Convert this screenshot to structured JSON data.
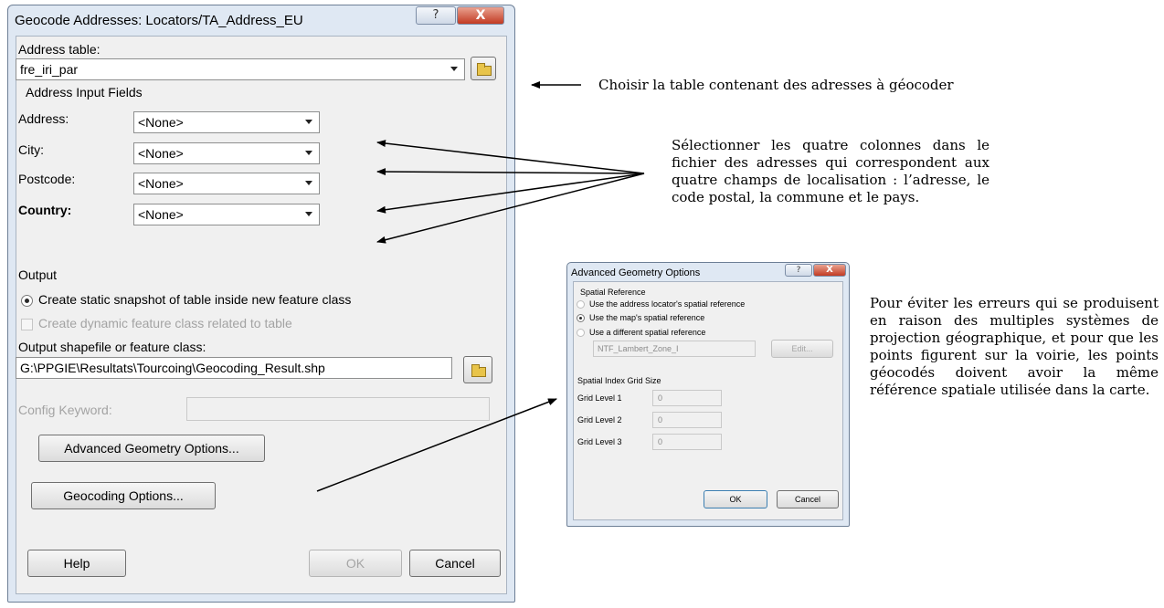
{
  "main_dialog": {
    "title": "Geocode Addresses: Locators/TA_Address_EU",
    "help_glyph": "?",
    "close_glyph": "X",
    "address_table_label": "Address table:",
    "address_table_value": "fre_iri_par",
    "input_fields_label": "Address Input Fields",
    "fields": [
      {
        "label": "Address:",
        "value": "<None>"
      },
      {
        "label": "City:",
        "value": "<None>"
      },
      {
        "label": "Postcode:",
        "value": "<None>"
      },
      {
        "label": "Country:",
        "value": "<None>"
      }
    ],
    "output_label": "Output",
    "option_static": "Create static snapshot of table inside new feature class",
    "option_dynamic": "Create dynamic feature class related to table",
    "output_path_label": "Output shapefile or feature class:",
    "output_path_value": "G:\\PPGIE\\Resultats\\Tourcoing\\Geocoding_Result.shp",
    "config_keyword_label": "Config Keyword:",
    "advanced_button": "Advanced Geometry Options...",
    "geocoding_button": "Geocoding Options...",
    "help_button": "Help",
    "ok_button": "OK",
    "cancel_button": "Cancel"
  },
  "advanced_dialog": {
    "title": "Advanced Geometry Options",
    "help_glyph": "?",
    "close_glyph": "X",
    "spatial_reference_label": "Spatial Reference",
    "option_locator": "Use the address locator's spatial reference",
    "option_map": "Use the map's spatial reference",
    "option_different": "Use a different spatial reference",
    "spatial_reference_value": "NTF_Lambert_Zone_I",
    "edit_button": "Edit...",
    "grid_size_label": "Spatial Index Grid Size",
    "grid_levels": [
      {
        "label": "Grid Level 1",
        "value": "0"
      },
      {
        "label": "Grid Level 2",
        "value": "0"
      },
      {
        "label": "Grid Level 3",
        "value": "0"
      }
    ],
    "ok_button": "OK",
    "cancel_button": "Cancel"
  },
  "annotations": {
    "table_caption": "Choisir la table contenant des adresses à géocoder",
    "fields_caption": "Sélectionner les quatre colonnes dans le fichier des adresses qui correspondent aux quatre champs de localisation : l’adresse, le code postal, la commune et le pays.",
    "advanced_caption": "Pour éviter les erreurs qui se produisent en raison des multiples systèmes de projection géographique, et pour que les points figurent sur la voirie, les points géocodés doivent avoir la même référence spatiale utilisée dans la carte."
  }
}
